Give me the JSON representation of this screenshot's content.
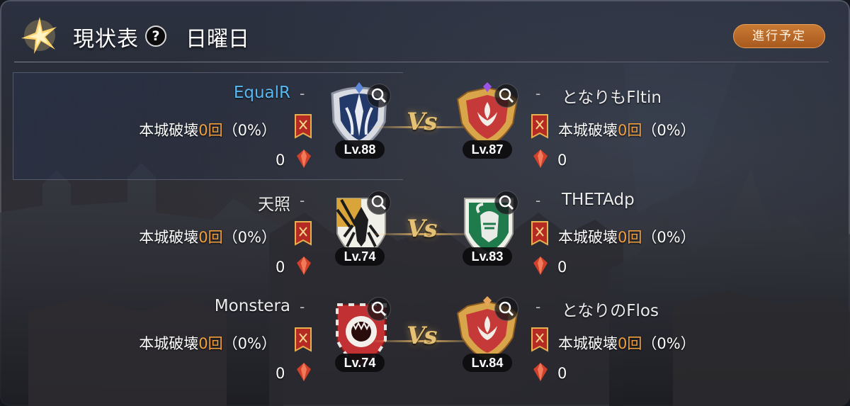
{
  "header": {
    "title": "現状表",
    "help_icon": "?",
    "day": "日曜日",
    "status_button": "進行予定"
  },
  "colors": {
    "self_name": "#58b8f2",
    "count_orange": "#f2a03f",
    "status_button": "#b8672a",
    "vs_gold": "#e4c174"
  },
  "dash": "-",
  "vs_label": "Vs",
  "matches": [
    {
      "left": {
        "name": "EqualR",
        "destroy_prefix": "本城破壊",
        "destroy_count": "0回",
        "destroy_pct": "（0%）",
        "score": "0",
        "level": "Lv.88",
        "emblem": "blue-dragon-crest-icon"
      },
      "right": {
        "name": "となりもFltin",
        "destroy_prefix": "本城破壊",
        "destroy_count": "0回",
        "destroy_pct": "（0%）",
        "score": "0",
        "level": "Lv.87",
        "emblem": "red-fleur-de-lis-crest-icon"
      }
    },
    {
      "left": {
        "name": "天照",
        "destroy_prefix": "本城破壊",
        "destroy_count": "0回",
        "destroy_pct": "（0%）",
        "score": "0",
        "level": "Lv.74",
        "emblem": "black-gold-spider-crest-icon"
      },
      "right": {
        "name": "THETAdp",
        "destroy_prefix": "本城破壊",
        "destroy_count": "0回",
        "destroy_pct": "（0%）",
        "score": "0",
        "level": "Lv.83",
        "emblem": "green-knight-helm-crest-icon"
      }
    },
    {
      "left": {
        "name": "Monstera",
        "destroy_prefix": "本城破壊",
        "destroy_count": "0回",
        "destroy_pct": "（0%）",
        "score": "0",
        "level": "Lv.74",
        "emblem": "red-fanged-maw-crest-icon"
      },
      "right": {
        "name": "となりのFlos",
        "destroy_prefix": "本城破壊",
        "destroy_count": "0回",
        "destroy_pct": "（0%）",
        "score": "0",
        "level": "Lv.84",
        "emblem": "red-fleur-de-lis-crest-icon"
      }
    }
  ]
}
